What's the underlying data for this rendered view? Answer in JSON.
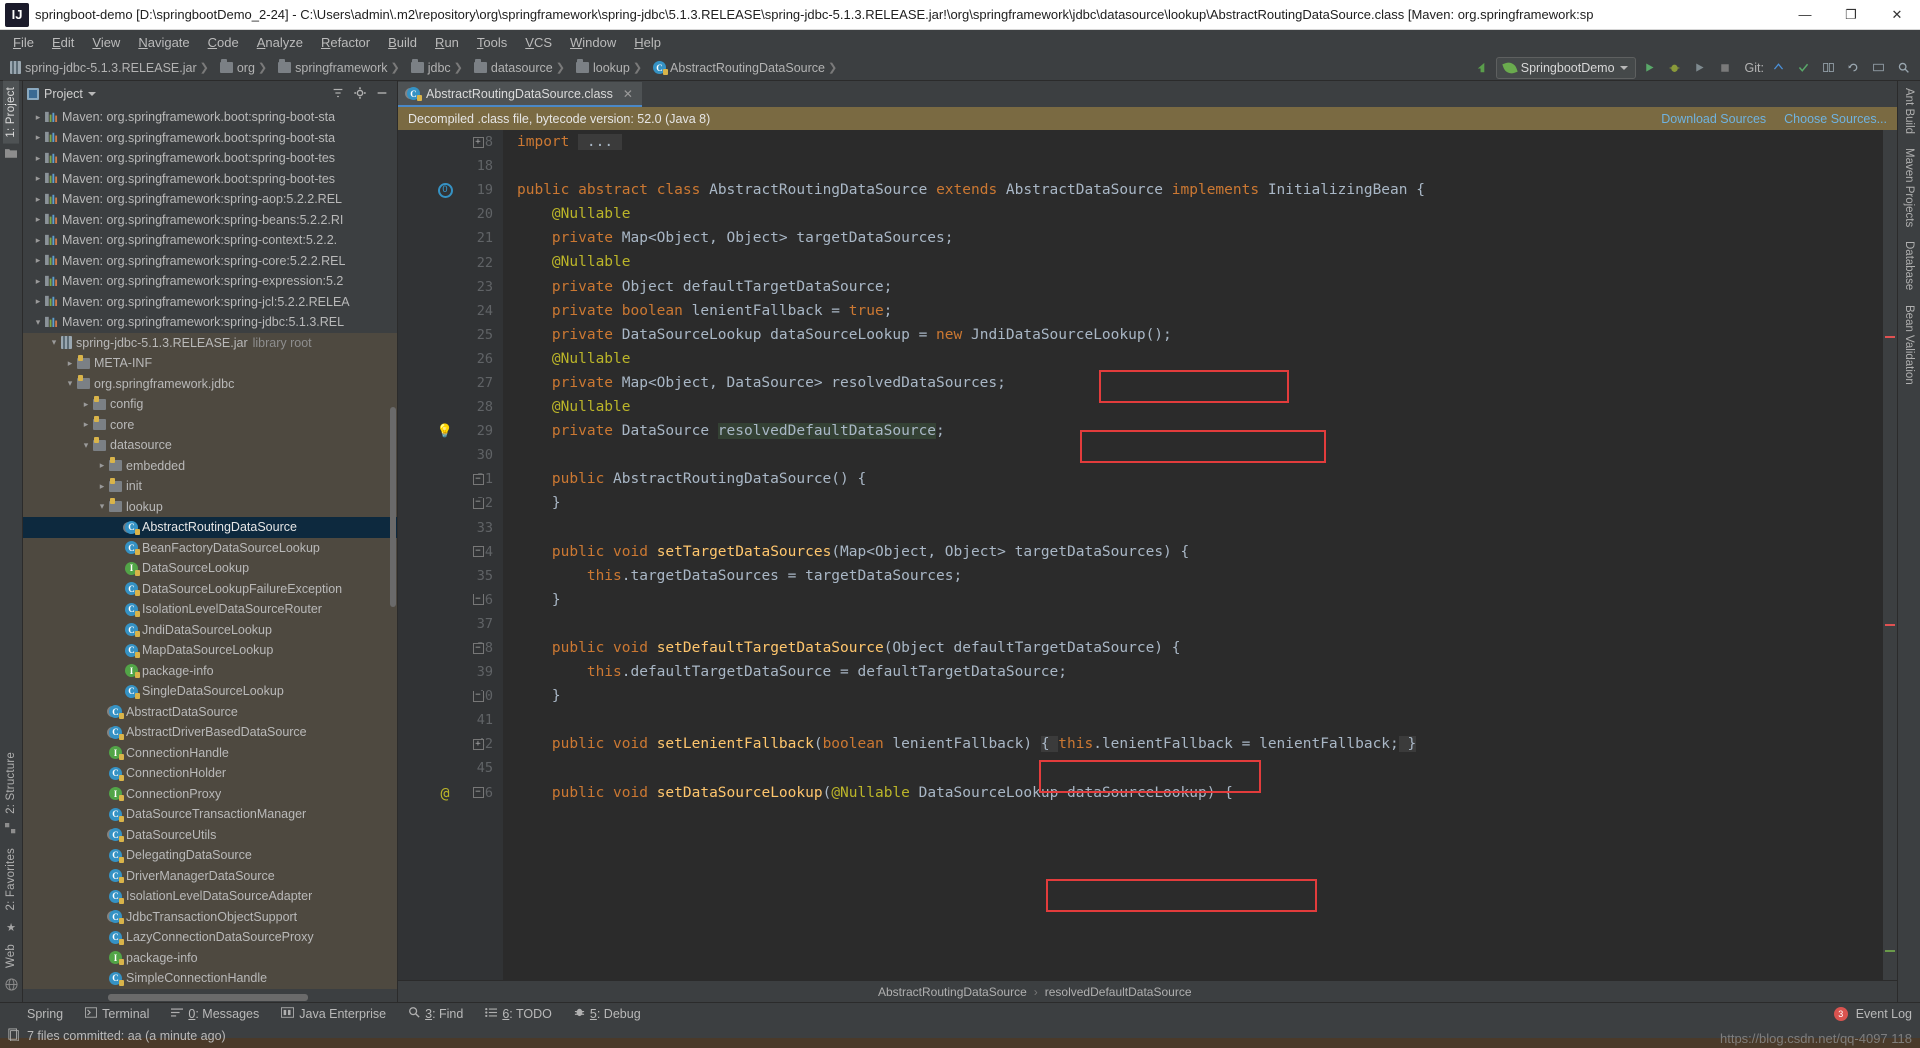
{
  "window": {
    "title": "springboot-demo [D:\\springbootDemo_2-24] - C:\\Users\\admin\\.m2\\repository\\org\\springframework\\spring-jdbc\\5.1.3.RELEASE\\spring-jdbc-5.1.3.RELEASE.jar!\\org\\springframework\\jdbc\\datasource\\lookup\\AbstractRoutingDataSource.class [Maven: org.springframework:sp",
    "logo": "IJ",
    "minimize": "—",
    "maximize": "❐",
    "close": "✕"
  },
  "menu": [
    "File",
    "Edit",
    "View",
    "Navigate",
    "Code",
    "Analyze",
    "Refactor",
    "Build",
    "Run",
    "Tools",
    "VCS",
    "Window",
    "Help"
  ],
  "breadcrumb": [
    {
      "label": "spring-jdbc-5.1.3.RELEASE.jar",
      "icon": "jar-icon"
    },
    {
      "label": "org",
      "icon": "folder-icon"
    },
    {
      "label": "springframework",
      "icon": "folder-icon"
    },
    {
      "label": "jdbc",
      "icon": "folder-icon"
    },
    {
      "label": "datasource",
      "icon": "folder-icon"
    },
    {
      "label": "lookup",
      "icon": "folder-icon"
    },
    {
      "label": "AbstractRoutingDataSource",
      "icon": "class-icon"
    }
  ],
  "toolbar": {
    "run_config": "SpringbootDemo",
    "vcs_label": "Git:",
    "icons": [
      "back-arrow-icon",
      "run-icon",
      "debug-icon",
      "coverage-icon",
      "stop-icon",
      "update-project-icon",
      "commit-icon",
      "rollback-icon",
      "search-everywhere-icon"
    ]
  },
  "project_panel": {
    "title": "Project",
    "icons": [
      "collapse-all-icon",
      "settings-gear-icon",
      "hide-icon"
    ],
    "tree": [
      {
        "depth": 1,
        "twisty": "▸",
        "icon": "maven-lib-icon",
        "label": "Maven: org.springframework.boot:spring-boot-sta",
        "style": "normal"
      },
      {
        "depth": 1,
        "twisty": "▸",
        "icon": "maven-lib-icon",
        "label": "Maven: org.springframework.boot:spring-boot-sta",
        "style": "normal"
      },
      {
        "depth": 1,
        "twisty": "▸",
        "icon": "maven-lib-icon",
        "label": "Maven: org.springframework.boot:spring-boot-tes",
        "style": "normal"
      },
      {
        "depth": 1,
        "twisty": "▸",
        "icon": "maven-lib-icon",
        "label": "Maven: org.springframework.boot:spring-boot-tes",
        "style": "normal"
      },
      {
        "depth": 1,
        "twisty": "▸",
        "icon": "maven-lib-icon",
        "label": "Maven: org.springframework:spring-aop:5.2.2.REL",
        "style": "normal"
      },
      {
        "depth": 1,
        "twisty": "▸",
        "icon": "maven-lib-icon",
        "label": "Maven: org.springframework:spring-beans:5.2.2.RI",
        "style": "normal"
      },
      {
        "depth": 1,
        "twisty": "▸",
        "icon": "maven-lib-icon",
        "label": "Maven: org.springframework:spring-context:5.2.2.",
        "style": "normal"
      },
      {
        "depth": 1,
        "twisty": "▸",
        "icon": "maven-lib-icon",
        "label": "Maven: org.springframework:spring-core:5.2.2.REL",
        "style": "normal"
      },
      {
        "depth": 1,
        "twisty": "▸",
        "icon": "maven-lib-icon",
        "label": "Maven: org.springframework:spring-expression:5.2",
        "style": "normal"
      },
      {
        "depth": 1,
        "twisty": "▸",
        "icon": "maven-lib-icon",
        "label": "Maven: org.springframework:spring-jcl:5.2.2.RELEA",
        "style": "normal"
      },
      {
        "depth": 1,
        "twisty": "▾",
        "icon": "maven-lib-icon",
        "label": "Maven: org.springframework:spring-jdbc:5.1.3.REL",
        "style": "normal"
      },
      {
        "depth": 2,
        "twisty": "▾",
        "icon": "jar-icon",
        "label": "spring-jdbc-5.1.3.RELEASE.jar",
        "suffix": "library root",
        "style": "inlib"
      },
      {
        "depth": 3,
        "twisty": "▸",
        "icon": "package-icon",
        "label": "META-INF",
        "style": "inlib"
      },
      {
        "depth": 3,
        "twisty": "▾",
        "icon": "package-icon",
        "label": "org.springframework.jdbc",
        "style": "inlib"
      },
      {
        "depth": 4,
        "twisty": "▸",
        "icon": "package-icon",
        "label": "config",
        "style": "inlib"
      },
      {
        "depth": 4,
        "twisty": "▸",
        "icon": "package-icon",
        "label": "core",
        "style": "inlib"
      },
      {
        "depth": 4,
        "twisty": "▾",
        "icon": "package-icon",
        "label": "datasource",
        "style": "inlib"
      },
      {
        "depth": 5,
        "twisty": "▸",
        "icon": "package-icon",
        "label": "embedded",
        "style": "inlib"
      },
      {
        "depth": 5,
        "twisty": "▸",
        "icon": "package-icon",
        "label": "init",
        "style": "inlib"
      },
      {
        "depth": 5,
        "twisty": "▾",
        "icon": "package-icon",
        "label": "lookup",
        "style": "inlib"
      },
      {
        "depth": 6,
        "twisty": "",
        "icon": "abstract-class-icon",
        "label": "AbstractRoutingDataSource",
        "style": "selected"
      },
      {
        "depth": 6,
        "twisty": "",
        "icon": "class-icon",
        "label": "BeanFactoryDataSourceLookup",
        "style": "inlib"
      },
      {
        "depth": 6,
        "twisty": "",
        "icon": "interface-icon",
        "label": "DataSourceLookup",
        "style": "inlib"
      },
      {
        "depth": 6,
        "twisty": "",
        "icon": "class-icon",
        "label": "DataSourceLookupFailureException",
        "style": "inlib"
      },
      {
        "depth": 6,
        "twisty": "",
        "icon": "class-icon",
        "label": "IsolationLevelDataSourceRouter",
        "style": "inlib"
      },
      {
        "depth": 6,
        "twisty": "",
        "icon": "class-icon",
        "label": "JndiDataSourceLookup",
        "style": "inlib"
      },
      {
        "depth": 6,
        "twisty": "",
        "icon": "class-icon",
        "label": "MapDataSourceLookup",
        "style": "inlib"
      },
      {
        "depth": 6,
        "twisty": "",
        "icon": "interface-icon",
        "label": "package-info",
        "style": "inlib"
      },
      {
        "depth": 6,
        "twisty": "",
        "icon": "class-icon",
        "label": "SingleDataSourceLookup",
        "style": "inlib"
      },
      {
        "depth": 5,
        "twisty": "",
        "icon": "abstract-class-icon",
        "label": "AbstractDataSource",
        "style": "inlib"
      },
      {
        "depth": 5,
        "twisty": "",
        "icon": "abstract-class-icon",
        "label": "AbstractDriverBasedDataSource",
        "style": "inlib"
      },
      {
        "depth": 5,
        "twisty": "",
        "icon": "interface-icon",
        "label": "ConnectionHandle",
        "style": "inlib"
      },
      {
        "depth": 5,
        "twisty": "",
        "icon": "class-icon",
        "label": "ConnectionHolder",
        "style": "inlib"
      },
      {
        "depth": 5,
        "twisty": "",
        "icon": "interface-icon",
        "label": "ConnectionProxy",
        "style": "inlib"
      },
      {
        "depth": 5,
        "twisty": "",
        "icon": "class-icon",
        "label": "DataSourceTransactionManager",
        "style": "inlib"
      },
      {
        "depth": 5,
        "twisty": "",
        "icon": "abstract-class-icon",
        "label": "DataSourceUtils",
        "style": "inlib"
      },
      {
        "depth": 5,
        "twisty": "",
        "icon": "class-icon",
        "label": "DelegatingDataSource",
        "style": "inlib"
      },
      {
        "depth": 5,
        "twisty": "",
        "icon": "class-icon",
        "label": "DriverManagerDataSource",
        "style": "inlib"
      },
      {
        "depth": 5,
        "twisty": "",
        "icon": "class-icon",
        "label": "IsolationLevelDataSourceAdapter",
        "style": "inlib"
      },
      {
        "depth": 5,
        "twisty": "",
        "icon": "abstract-class-icon",
        "label": "JdbcTransactionObjectSupport",
        "style": "inlib"
      },
      {
        "depth": 5,
        "twisty": "",
        "icon": "class-icon",
        "label": "LazyConnectionDataSourceProxy",
        "style": "inlib"
      },
      {
        "depth": 5,
        "twisty": "",
        "icon": "interface-icon",
        "label": "package-info",
        "style": "inlib"
      },
      {
        "depth": 5,
        "twisty": "",
        "icon": "class-icon",
        "label": "SimpleConnectionHandle",
        "style": "inlib"
      }
    ]
  },
  "left_rail": [
    "1: Project",
    "2: Structure",
    "2: Favorites",
    "Web"
  ],
  "right_rail": [
    "Ant Build",
    "Maven Projects",
    "Database",
    "Bean Validation"
  ],
  "editor": {
    "tab": {
      "label": "AbstractRoutingDataSource.class",
      "icon": "abstract-class-icon",
      "close": "✕"
    },
    "notice": {
      "text": "Decompiled .class file, bytecode version: 52.0 (Java 8)",
      "link_download": "Download Sources",
      "link_choose": "Choose Sources..."
    },
    "lines": [
      {
        "num": "8",
        "fold": "+",
        "marker": "",
        "html": "<span class=\"kw\">import</span> <span class=\"hl-import\"> ... </span>"
      },
      {
        "num": "18",
        "fold": "",
        "marker": "",
        "html": ""
      },
      {
        "num": "19",
        "fold": "",
        "marker": "override",
        "html": "<span class=\"kw\">public</span> <span class=\"kw\">abstract</span> <span class=\"kw\">class</span> AbstractRoutingDataSource <span class=\"kw\">extends</span> AbstractDataSource <span class=\"kw\">implements</span> InitializingBean {"
      },
      {
        "num": "20",
        "fold": "",
        "marker": "",
        "html": "    <span class=\"ann\">@Nullable</span>"
      },
      {
        "num": "21",
        "fold": "",
        "marker": "",
        "html": "    <span class=\"kw\">private</span> Map&lt;Object, Object&gt; targetDataSources;"
      },
      {
        "num": "22",
        "fold": "",
        "marker": "",
        "html": "    <span class=\"ann\">@Nullable</span>"
      },
      {
        "num": "23",
        "fold": "",
        "marker": "",
        "html": "    <span class=\"kw\">private</span> Object defaultTargetDataSource;"
      },
      {
        "num": "24",
        "fold": "",
        "marker": "",
        "html": "    <span class=\"kw\">private</span> <span class=\"kw\">boolean</span> lenientFallback = <span class=\"kw\">true</span>;"
      },
      {
        "num": "25",
        "fold": "",
        "marker": "",
        "html": "    <span class=\"kw\">private</span> DataSourceLookup dataSourceLookup = <span class=\"kw\">new</span> JndiDataSourceLookup();"
      },
      {
        "num": "26",
        "fold": "",
        "marker": "",
        "html": "    <span class=\"ann\">@Nullable</span>"
      },
      {
        "num": "27",
        "fold": "",
        "marker": "",
        "html": "    <span class=\"kw\">private</span> Map&lt;Object, DataSource&gt; resolvedDataSources;"
      },
      {
        "num": "28",
        "fold": "",
        "marker": "",
        "html": "    <span class=\"ann\">@Nullable</span>"
      },
      {
        "num": "29",
        "fold": "",
        "marker": "bulb",
        "html": "    <span class=\"kw\">private</span> DataSource <span class=\"hl-fld\">resolvedDefaultDataSource</span>;"
      },
      {
        "num": "30",
        "fold": "",
        "marker": "",
        "html": ""
      },
      {
        "num": "31",
        "fold": "-",
        "marker": "",
        "html": "    <span class=\"kw\">public</span> AbstractRoutingDataSource() {"
      },
      {
        "num": "32",
        "fold": "e",
        "marker": "",
        "html": "    }"
      },
      {
        "num": "33",
        "fold": "",
        "marker": "",
        "html": ""
      },
      {
        "num": "34",
        "fold": "-",
        "marker": "",
        "html": "    <span class=\"kw\">public</span> <span class=\"kw\">void</span> <span class=\"mth\">setTargetDataSources</span>(Map&lt;Object, Object&gt; targetDataSources) {"
      },
      {
        "num": "35",
        "fold": "",
        "marker": "",
        "html": "        <span class=\"kw\">this</span>.targetDataSources = targetDataSources;"
      },
      {
        "num": "36",
        "fold": "e",
        "marker": "",
        "html": "    }"
      },
      {
        "num": "37",
        "fold": "",
        "marker": "",
        "html": ""
      },
      {
        "num": "38",
        "fold": "-",
        "marker": "",
        "html": "    <span class=\"kw\">public</span> <span class=\"kw\">void</span> <span class=\"mth\">setDefaultTargetDataSource</span>(Object defaultTargetDataSource) {"
      },
      {
        "num": "39",
        "fold": "",
        "marker": "",
        "html": "        <span class=\"kw\">this</span>.defaultTargetDataSource = defaultTargetDataSource;"
      },
      {
        "num": "40",
        "fold": "e",
        "marker": "",
        "html": "    }"
      },
      {
        "num": "41",
        "fold": "",
        "marker": "",
        "html": ""
      },
      {
        "num": "42",
        "fold": "+",
        "marker": "",
        "html": "    <span class=\"kw\">public</span> <span class=\"kw\">void</span> <span class=\"mth\">setLenientFallback</span>(<span class=\"kw\">boolean</span> lenientFallback) <span class=\"hl-import\">{ </span><span class=\"kw\">this</span>.lenientFallback = lenientFallback;<span class=\"hl-import\"> }</span>"
      },
      {
        "num": "45",
        "fold": "",
        "marker": "",
        "html": ""
      },
      {
        "num": "46",
        "fold": "-",
        "marker": "at",
        "html": "    <span class=\"kw\">public</span> <span class=\"kw\">void</span> <span class=\"mth\">setDataSourceLookup</span>(<span class=\"ann\">@Nullable</span> DataSourceLookup dataSourceLookup) {"
      }
    ],
    "highlight_boxes": [
      {
        "label": "targetDataSources-field-box"
      },
      {
        "label": "defaultTargetDataSource-field-box"
      },
      {
        "label": "setTargetDataSources-method-box"
      },
      {
        "label": "setDefaultTargetDataSource-method-box"
      }
    ],
    "status_breadcrumb": [
      "AbstractRoutingDataSource",
      "resolvedDefaultDataSource"
    ]
  },
  "bottom_bar": {
    "items": [
      {
        "label": "Spring",
        "icon": "spring-leaf-icon"
      },
      {
        "label": "Terminal",
        "icon": "terminal-icon"
      },
      {
        "label": "0: Messages",
        "icon": "messages-icon",
        "mnemonic": "0"
      },
      {
        "label": "Java Enterprise",
        "icon": "java-enterprise-icon"
      },
      {
        "label": "3: Find",
        "icon": "find-icon",
        "mnemonic": "3"
      },
      {
        "label": "6: TODO",
        "icon": "todo-icon",
        "mnemonic": "6"
      },
      {
        "label": "5: Debug",
        "icon": "debug-bug-icon",
        "mnemonic": "5"
      }
    ],
    "event_log": {
      "label": "Event Log",
      "count": "3"
    }
  },
  "status_bar": {
    "message": "7 files committed: aa (a minute ago)",
    "icon": "vcs-commit-icon",
    "watermark": "https://blog.csdn.net/qq-4097 118"
  },
  "colors": {
    "accent": "#4a88c7",
    "highlight_box": "#e23c3c",
    "notice_bg": "#7a6a42",
    "selection": "#0d293e",
    "library_bg": "#4e4940"
  }
}
